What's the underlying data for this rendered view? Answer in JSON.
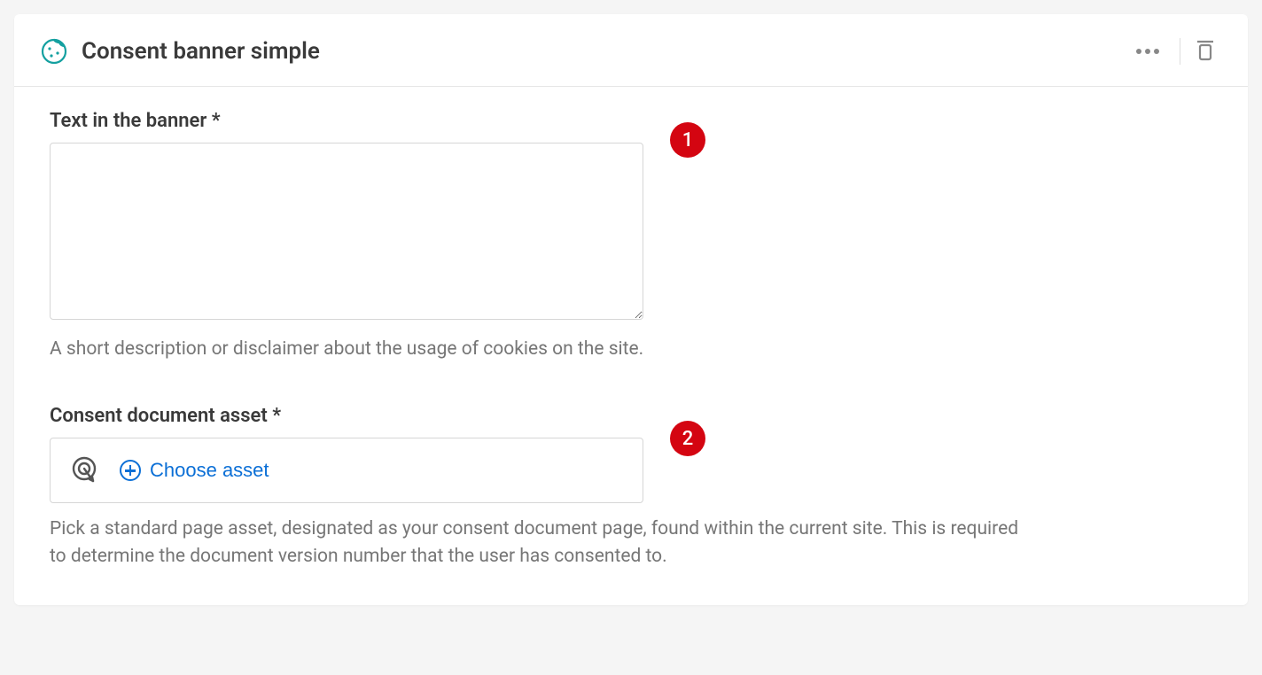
{
  "header": {
    "title": "Consent banner simple"
  },
  "fields": {
    "bannerText": {
      "label": "Text in the banner *",
      "value": "",
      "help": "A short description or disclaimer about the usage of cookies on the site.",
      "badge": "1"
    },
    "consentAsset": {
      "label": "Consent document asset *",
      "chooseLabel": "Choose asset",
      "help": "Pick a standard page asset, designated as your consent document page, found within the current site. This is required to determine the document version number that the user has consented to.",
      "badge": "2"
    }
  }
}
